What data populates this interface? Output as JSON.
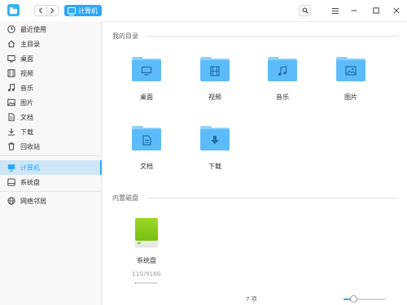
{
  "titlebar": {
    "back_icon": "chevron-left-icon",
    "forward_icon": "chevron-right-icon",
    "breadcrumb_label": "计算机"
  },
  "sidebar": {
    "items": [
      {
        "label": "最近使用",
        "icon": "clock-icon"
      },
      {
        "label": "主目录",
        "icon": "home-icon"
      },
      {
        "label": "桌面",
        "icon": "desktop-icon"
      },
      {
        "label": "视频",
        "icon": "video-icon"
      },
      {
        "label": "音乐",
        "icon": "music-icon"
      },
      {
        "label": "图片",
        "icon": "picture-icon"
      },
      {
        "label": "文档",
        "icon": "document-icon"
      },
      {
        "label": "下载",
        "icon": "download-icon"
      },
      {
        "label": "回收站",
        "icon": "trash-icon"
      },
      {
        "label": "计算机",
        "icon": "computer-icon",
        "active": true
      },
      {
        "label": "系统盘",
        "icon": "disk-icon"
      },
      {
        "label": "网络邻居",
        "icon": "network-icon"
      }
    ]
  },
  "main": {
    "my_dirs_title": "我的目录",
    "folders": [
      {
        "label": "桌面",
        "icon": "desktop-folder-icon"
      },
      {
        "label": "视频",
        "icon": "video-folder-icon"
      },
      {
        "label": "音乐",
        "icon": "music-folder-icon"
      },
      {
        "label": "图片",
        "icon": "picture-folder-icon"
      },
      {
        "label": "文档",
        "icon": "document-folder-icon"
      },
      {
        "label": "下载",
        "icon": "download-folder-icon"
      }
    ],
    "disks_title": "内置磁盘",
    "disk": {
      "label": "系统盘",
      "size": "11G/916G",
      "usage_fraction": 0.012
    }
  },
  "status": {
    "item_count": "7 项",
    "zoom_level_fraction": 0.25
  },
  "colors": {
    "accent": "#2ca7f8",
    "folder": "#5cbcf9",
    "disk": "#8bcf1c",
    "sidebar_active_bg": "#cfe6f8"
  }
}
